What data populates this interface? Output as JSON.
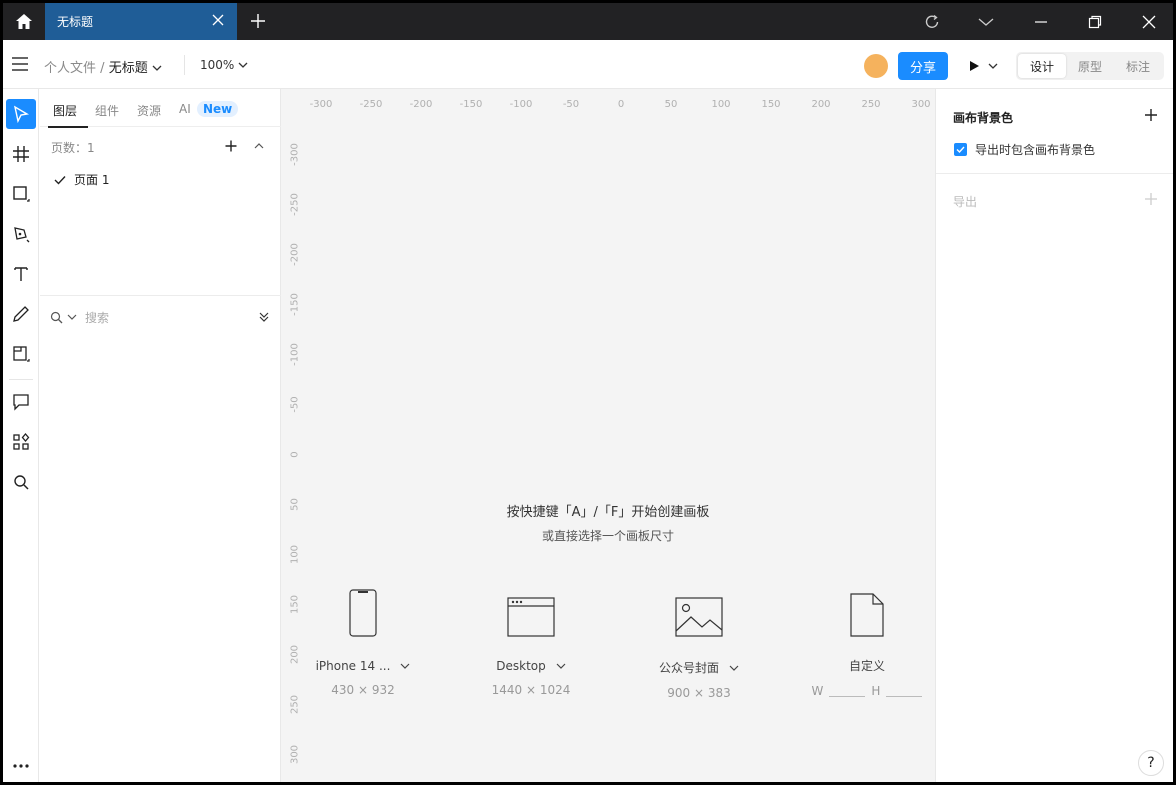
{
  "titlebar": {
    "tab_title": "无标题"
  },
  "toolbar": {
    "breadcrumb_parent": "个人文件",
    "breadcrumb_sep": "/",
    "file_name": "无标题",
    "zoom": "100%",
    "share_label": "分享",
    "modes": [
      "设计",
      "原型",
      "标注"
    ],
    "active_mode": "设计"
  },
  "layers_panel": {
    "tabs": [
      "图层",
      "组件",
      "资源",
      "AI"
    ],
    "ai_badge": "New",
    "pages_header": "页数：1",
    "pages": [
      "页面 1"
    ],
    "search_placeholder": "搜索"
  },
  "canvas": {
    "h_ruler": [
      "-300",
      "-250",
      "-200",
      "-150",
      "-100",
      "-50",
      "0",
      "50",
      "100",
      "150",
      "200",
      "250",
      "300"
    ],
    "v_ruler": [
      "-300",
      "-250",
      "-200",
      "-150",
      "-100",
      "-50",
      "0",
      "50",
      "100",
      "150",
      "200",
      "250",
      "300"
    ],
    "hint_title": "按快捷键「A」/「F」开始创建画板",
    "hint_sub": "或直接选择一个画板尺寸",
    "presets": [
      {
        "name": "iPhone 14 ...",
        "size": "430 × 932",
        "icon": "phone-icon"
      },
      {
        "name": "Desktop",
        "size": "1440 × 1024",
        "icon": "browser-window-icon"
      },
      {
        "name": "公众号封面",
        "size": "900 × 383",
        "icon": "image-icon"
      }
    ],
    "custom": {
      "name": "自定义",
      "w_label": "W",
      "h_label": "H"
    }
  },
  "right_panel": {
    "canvas_bg_title": "画布背景色",
    "include_bg_label": "导出时包含画布背景色",
    "include_bg_checked": true,
    "export_title": "导出",
    "help": "?"
  },
  "colors": {
    "accent": "#1a8cff",
    "tab_bg": "#1f5d97",
    "titlebar_bg": "#222224",
    "avatar": "#f5b25d"
  }
}
